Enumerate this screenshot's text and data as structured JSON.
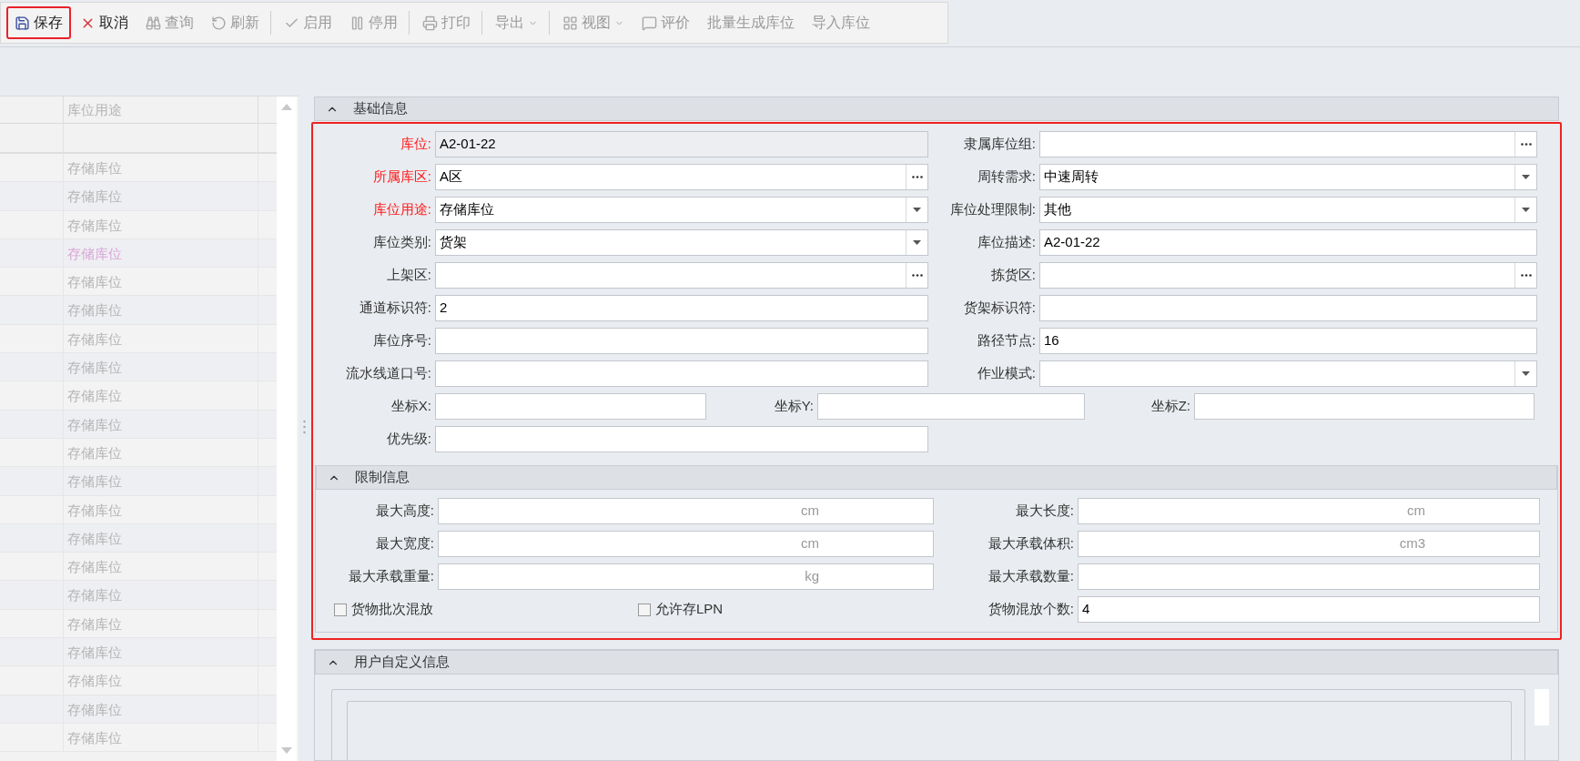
{
  "toolbar": [
    {
      "label": "保存",
      "disabled": false,
      "highlighted": true,
      "dropdown": false,
      "separator_after": false
    },
    {
      "label": "取消",
      "disabled": false,
      "highlighted": false,
      "dropdown": false,
      "separator_after": false
    },
    {
      "label": "查询",
      "disabled": true,
      "highlighted": false,
      "dropdown": false,
      "separator_after": false
    },
    {
      "label": "刷新",
      "disabled": true,
      "highlighted": false,
      "dropdown": false,
      "separator_after": true
    },
    {
      "label": "启用",
      "disabled": true,
      "highlighted": false,
      "dropdown": false,
      "separator_after": false
    },
    {
      "label": "停用",
      "disabled": true,
      "highlighted": false,
      "dropdown": false,
      "separator_after": true
    },
    {
      "label": "打印",
      "disabled": true,
      "highlighted": false,
      "dropdown": false,
      "separator_after": true
    },
    {
      "label": "导出",
      "disabled": true,
      "highlighted": false,
      "dropdown": true,
      "separator_after": true
    },
    {
      "label": "视图",
      "disabled": true,
      "highlighted": false,
      "dropdown": true,
      "separator_after": false
    },
    {
      "label": "评价",
      "disabled": true,
      "highlighted": false,
      "dropdown": false,
      "separator_after": false
    },
    {
      "label": "批量生成库位",
      "disabled": true,
      "highlighted": false,
      "dropdown": false,
      "separator_after": false
    },
    {
      "label": "导入库位",
      "disabled": true,
      "highlighted": false,
      "dropdown": false,
      "separator_after": false
    }
  ],
  "grid": {
    "column": "库位用途",
    "rows": [
      {
        "value": "存储库位",
        "selected": false
      },
      {
        "value": "存储库位",
        "selected": false
      },
      {
        "value": "存储库位",
        "selected": false
      },
      {
        "value": "存储库位",
        "selected": true
      },
      {
        "value": "存储库位",
        "selected": false
      },
      {
        "value": "存储库位",
        "selected": false
      },
      {
        "value": "存储库位",
        "selected": false
      },
      {
        "value": "存储库位",
        "selected": false
      },
      {
        "value": "存储库位",
        "selected": false
      },
      {
        "value": "存储库位",
        "selected": false
      },
      {
        "value": "存储库位",
        "selected": false
      },
      {
        "value": "存储库位",
        "selected": false
      },
      {
        "value": "存储库位",
        "selected": false
      },
      {
        "value": "存储库位",
        "selected": false
      },
      {
        "value": "存储库位",
        "selected": false
      },
      {
        "value": "存储库位",
        "selected": false
      },
      {
        "value": "存储库位",
        "selected": false
      },
      {
        "value": "存储库位",
        "selected": false
      },
      {
        "value": "存储库位",
        "selected": false
      },
      {
        "value": "存储库位",
        "selected": false
      },
      {
        "value": "存储库位",
        "selected": false
      }
    ]
  },
  "form_highlighted": true,
  "basic_info": {
    "title": "基础信息",
    "expanded": true,
    "rows": [
      {
        "kind": "pair",
        "fields": [
          {
            "label": "库位:",
            "value": "A2-01-22",
            "kind": "readonly",
            "required": true
          },
          {
            "label": "隶属库位组:",
            "kind": "lookup",
            "required": false
          }
        ]
      },
      {
        "kind": "pair",
        "fields": [
          {
            "label": "所属库区:",
            "value": "A区",
            "kind": "lookup",
            "required": true
          },
          {
            "label": "周转需求:",
            "value": "中速周转",
            "kind": "dropdown",
            "required": false
          }
        ]
      },
      {
        "kind": "pair",
        "fields": [
          {
            "label": "库位用途:",
            "value": "存储库位",
            "kind": "dropdown",
            "required": true
          },
          {
            "label": "库位处理限制:",
            "value": "其他",
            "kind": "dropdown",
            "required": false
          }
        ]
      },
      {
        "kind": "pair",
        "fields": [
          {
            "label": "库位类别:",
            "value": "货架",
            "kind": "dropdown",
            "required": false
          },
          {
            "label": "库位描述:",
            "value": "A2-01-22",
            "kind": "text",
            "required": false
          }
        ]
      },
      {
        "kind": "pair",
        "fields": [
          {
            "label": "上架区:",
            "kind": "lookup",
            "required": false
          },
          {
            "label": "拣货区:",
            "kind": "lookup",
            "required": false
          }
        ]
      },
      {
        "kind": "pair",
        "fields": [
          {
            "label": "通道标识符:",
            "value": "2",
            "kind": "text",
            "required": false
          },
          {
            "label": "货架标识符:",
            "kind": "text",
            "required": false
          }
        ]
      },
      {
        "kind": "pair",
        "fields": [
          {
            "label": "库位序号:",
            "kind": "text",
            "required": false
          },
          {
            "label": "路径节点:",
            "value": "16",
            "kind": "text",
            "required": false
          }
        ]
      },
      {
        "kind": "pair",
        "fields": [
          {
            "label": "流水线道口号:",
            "kind": "text",
            "required": false
          },
          {
            "label": "作业模式:",
            "kind": "dropdown",
            "required": false
          }
        ]
      },
      {
        "kind": "triple",
        "fields": [
          {
            "label": "坐标X:",
            "kind": "text",
            "required": false
          },
          {
            "label": "坐标Y:",
            "kind": "text",
            "required": false
          },
          {
            "label": "坐标Z:",
            "kind": "text",
            "required": false
          }
        ]
      },
      {
        "kind": "single",
        "fields": [
          {
            "label": "优先级:",
            "kind": "text",
            "required": false
          }
        ]
      }
    ]
  },
  "limits": {
    "title": "限制信息",
    "expanded": true,
    "rows": [
      {
        "kind": "pair",
        "fields": [
          {
            "label": "最大高度:",
            "unit": "cm"
          },
          {
            "label": "最大长度:",
            "unit": "cm"
          }
        ]
      },
      {
        "kind": "pair",
        "fields": [
          {
            "label": "最大宽度:",
            "unit": "cm"
          },
          {
            "label": "最大承载体积:",
            "unit": "cm3"
          }
        ]
      },
      {
        "kind": "pair",
        "fields": [
          {
            "label": "最大承载重量:",
            "unit": "kg"
          },
          {
            "label": "最大承载数量:"
          }
        ]
      },
      {
        "kind": "checks",
        "checkboxes": [
          {
            "label": "货物批次混放",
            "checked": false
          },
          {
            "label": "允许存LPN",
            "checked": false
          }
        ],
        "field": {
          "label": "货物混放个数:",
          "value": "4"
        }
      }
    ]
  },
  "custom_info": {
    "title": "用户自定义信息",
    "expanded": true
  }
}
